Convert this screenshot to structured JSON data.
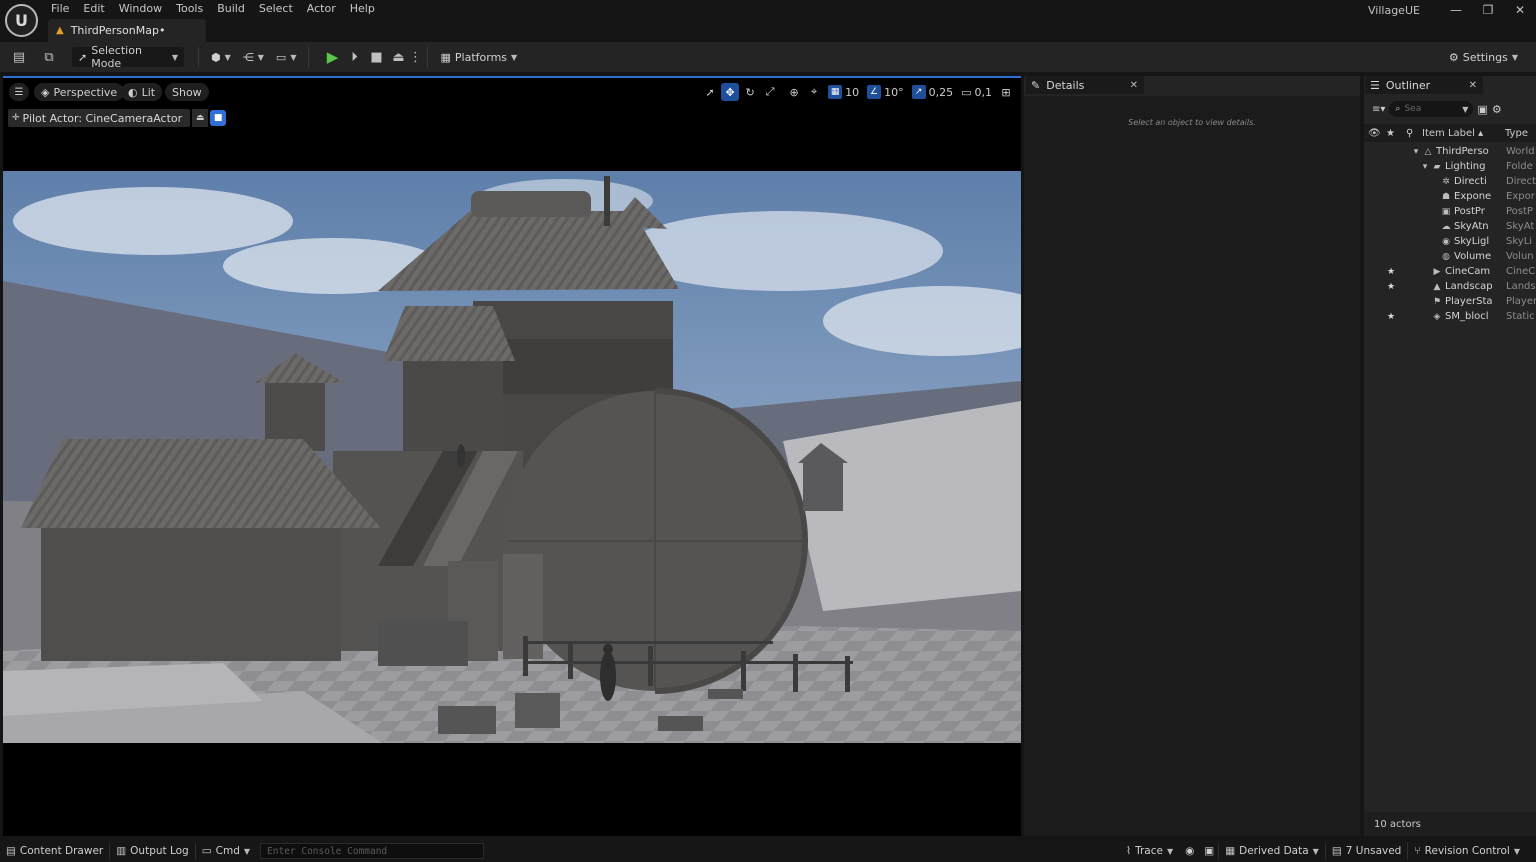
{
  "app": {
    "logo": "U",
    "project_name": "VillageUE",
    "document_tab": "ThirdPersonMap•",
    "window_controls": {
      "minimize": "—",
      "restore": "❐",
      "close": "✕"
    }
  },
  "menu": [
    "File",
    "Edit",
    "Window",
    "Tools",
    "Build",
    "Select",
    "Actor",
    "Help"
  ],
  "toolbar": {
    "selection_mode": "Selection Mode",
    "platforms": "Platforms",
    "settings": "Settings"
  },
  "viewport": {
    "perspective": "Perspective",
    "lit": "Lit",
    "show": "Show",
    "grid_snap": "10",
    "rotation_snap": "10°",
    "scale_snap": "0,25",
    "camera_speed": "0,1",
    "pilot_actor": "Pilot Actor: CineCameraActor"
  },
  "details": {
    "tab_label": "Details",
    "empty_message": "Select an object to view details."
  },
  "outliner": {
    "tab_label": "Outliner",
    "search_placeholder": "Sea",
    "columns": {
      "label": "Item Label ▴",
      "type": "Type"
    },
    "rows": [
      {
        "name": "ThirdPerso",
        "type": "World",
        "indent": 2,
        "expander": "▾",
        "icon": "△",
        "star": ""
      },
      {
        "name": "Lighting",
        "type": "Folde",
        "indent": 3,
        "expander": "▾",
        "icon": "▰",
        "star": ""
      },
      {
        "name": "Directi",
        "type": "Direct",
        "indent": 4,
        "expander": "",
        "icon": "✲",
        "star": ""
      },
      {
        "name": "Expone",
        "type": "Expor",
        "indent": 4,
        "expander": "",
        "icon": "☗",
        "star": ""
      },
      {
        "name": "PostPr",
        "type": "PostP",
        "indent": 4,
        "expander": "",
        "icon": "▣",
        "star": ""
      },
      {
        "name": "SkyAtn",
        "type": "SkyAt",
        "indent": 4,
        "expander": "",
        "icon": "☁",
        "star": ""
      },
      {
        "name": "SkyLigl",
        "type": "SkyLi",
        "indent": 4,
        "expander": "",
        "icon": "◉",
        "star": ""
      },
      {
        "name": "Volume",
        "type": "Volun",
        "indent": 4,
        "expander": "",
        "icon": "◍",
        "star": ""
      },
      {
        "name": "CineCam",
        "type": "CineC",
        "indent": 3,
        "expander": "",
        "icon": "▶",
        "star": "★"
      },
      {
        "name": "Landscap",
        "type": "Lands",
        "indent": 3,
        "expander": "",
        "icon": "▲",
        "star": "★"
      },
      {
        "name": "PlayerSta",
        "type": "Player",
        "indent": 3,
        "expander": "",
        "icon": "⚑",
        "star": ""
      },
      {
        "name": "SM_blocl",
        "type": "Static",
        "indent": 3,
        "expander": "",
        "icon": "◈",
        "star": "★"
      }
    ],
    "actor_count": "10 actors"
  },
  "statusbar": {
    "content_drawer": "Content Drawer",
    "output_log": "Output Log",
    "cmd": "Cmd",
    "console_placeholder": "Enter Console Command",
    "trace": "Trace",
    "derived_data": "Derived Data",
    "unsaved": "7 Unsaved",
    "revision_control": "Revision Control"
  },
  "colors": {
    "accent_blue": "#2e6fd3",
    "play_green": "#58c84a",
    "warning": "#e0a020"
  }
}
